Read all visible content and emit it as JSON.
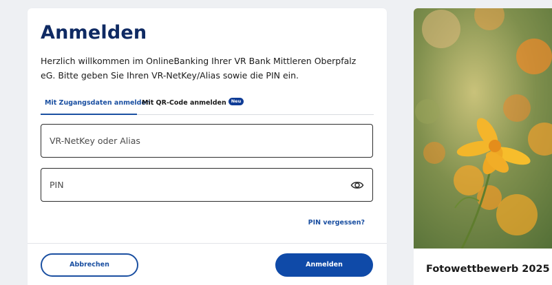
{
  "login": {
    "title": "Anmelden",
    "intro": "Herzlich willkommen im OnlineBanking Ihrer VR Bank Mittleren Oberpfalz eG. Bitte geben Sie Ihren VR-NetKey/Alias sowie die PIN ein.",
    "tabs": [
      {
        "label": "Mit Zugangsdaten anmelden",
        "active": true
      },
      {
        "label": "Mit QR-Code anmelden",
        "badge": "Neu",
        "active": false
      }
    ],
    "username": {
      "placeholder": "VR-NetKey oder Alias",
      "value": ""
    },
    "pin": {
      "placeholder": "PIN",
      "value": ""
    },
    "forgot_pin": "PIN vergessen?",
    "cancel_label": "Abbrechen",
    "submit_label": "Anmelden"
  },
  "promo": {
    "caption": "Fotowettbewerb 2025 -"
  },
  "icons": {
    "pin_visibility": "eye-icon"
  },
  "colors": {
    "title": "#0f2a63",
    "accent": "#1a4fa1",
    "primary_button": "#0f4aa8",
    "background": "#eef0f3"
  }
}
